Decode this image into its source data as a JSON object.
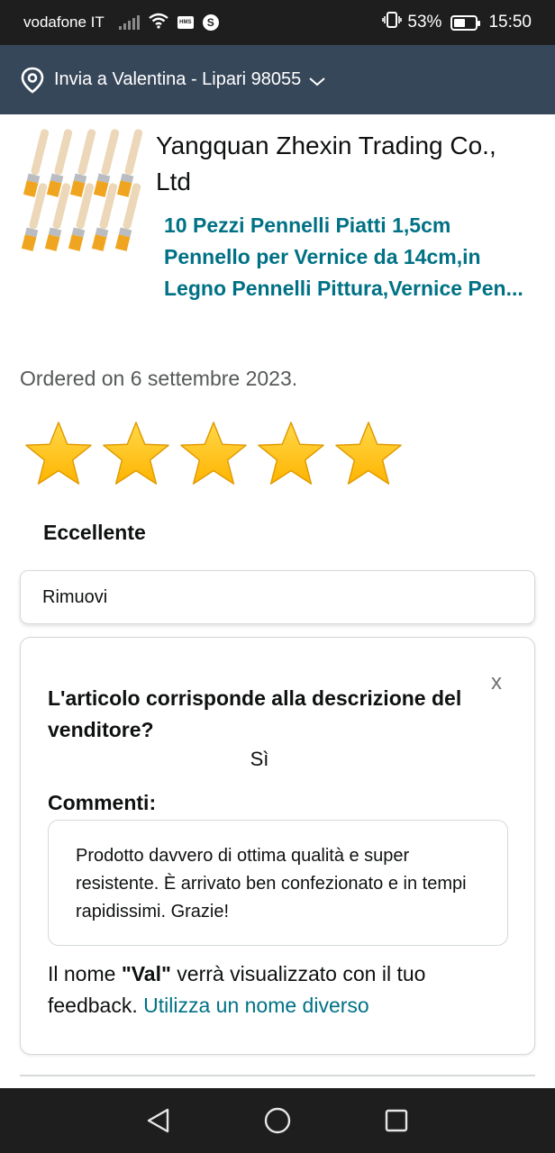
{
  "status_bar": {
    "carrier": "vodafone IT",
    "hms_badge": "HMS",
    "battery_percent": "53%",
    "battery_level": 0.53,
    "time": "15:50"
  },
  "delivery": {
    "text": "Invia a Valentina - Lipari 98055",
    "icon": "location-pin-icon"
  },
  "product": {
    "seller": "Yangquan Zhexin Trading Co., Ltd",
    "title": "10 Pezzi Pennelli Piatti 1,5cm Pennello per Vernice da 14cm,in Legno Pennelli Pittura,Vernice Pen...",
    "ordered": "Ordered on 6 settembre 2023."
  },
  "rating": {
    "stars": 5,
    "max": 5,
    "label": "Eccellente",
    "star_color": "#ffb400"
  },
  "remove_label": "Rimuovi",
  "feedback": {
    "close": "x",
    "question": "L'articolo corrisponde alla descrizione del venditore?",
    "answer": "Sì",
    "comments_label": "Commenti:",
    "comment_text": "Prodotto davvero di ottima qualità e super resistente. È arrivato ben confezionato e in tempi rapidissimi. Grazie!",
    "name_prefix": "Il nome ",
    "name_value": "\"Val\"",
    "name_suffix": " verrà visualizzato con il tuo feedback. ",
    "name_link": "Utilizza un nome diverso"
  },
  "colors": {
    "header_bg": "#37475a",
    "link": "#007185",
    "text": "#0f1111",
    "muted": "#565959"
  },
  "nav": {
    "back": "back-triangle-icon",
    "home": "home-circle-icon",
    "recents": "recents-square-icon"
  }
}
